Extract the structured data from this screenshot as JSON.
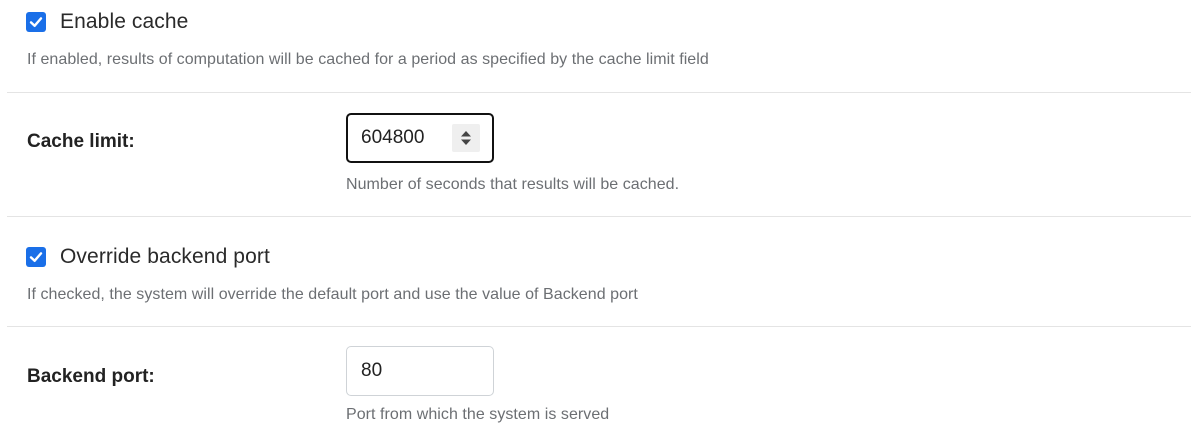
{
  "enable_cache": {
    "checked": true,
    "label": "Enable cache",
    "help": "If enabled, results of computation will be cached for a period as specified by the cache limit field"
  },
  "cache_limit": {
    "label": "Cache limit:",
    "value": "604800",
    "help": "Number of seconds that results will be cached."
  },
  "override_port": {
    "checked": true,
    "label": "Override backend port",
    "help": "If checked, the system will override the default port and use the value of Backend port"
  },
  "backend_port": {
    "label": "Backend port:",
    "value": "80",
    "help": "Port from which the system is served"
  },
  "icons": {
    "checkbox_check": "check-icon",
    "stepper": "stepper-arrows-icon"
  },
  "colors": {
    "checkbox_accent": "#1a6fe8",
    "help_text": "#6c6f73",
    "divider": "#e4e4e4",
    "focus_border": "#111111"
  }
}
